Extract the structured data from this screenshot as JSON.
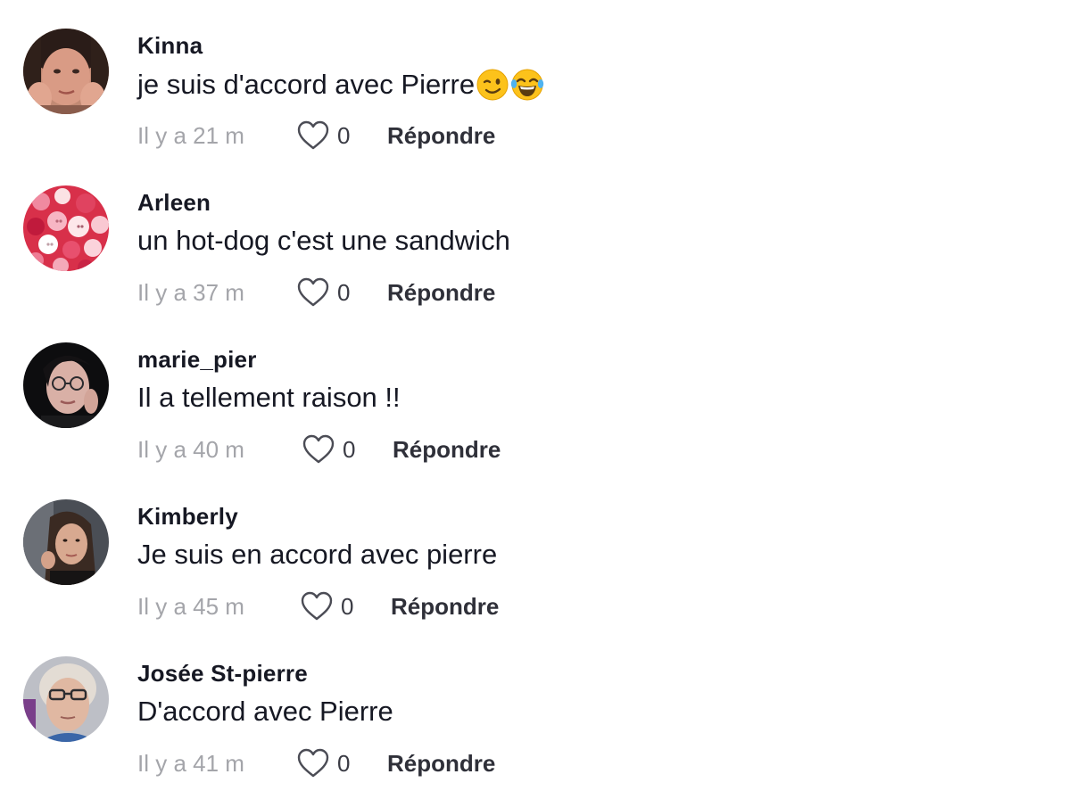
{
  "comments": [
    {
      "username": "Kinna",
      "text": "je suis d'accord avec Pierre",
      "emojis": [
        "winking-face",
        "face-with-tears-of-joy"
      ],
      "time": "Il y a 21 m",
      "likes": "0",
      "reply_label": "Répondre"
    },
    {
      "username": "Arleen",
      "text": "un hot-dog c'est une sandwich",
      "time": "Il y a 37 m",
      "likes": "0",
      "reply_label": "Répondre"
    },
    {
      "username": "marie_pier",
      "text": "Il a tellement raison !!",
      "time": "Il y a 40 m",
      "likes": "0",
      "reply_label": "Répondre"
    },
    {
      "username": "Kimberly",
      "text": "Je suis en accord avec pierre",
      "time": "Il y a 45 m",
      "likes": "0",
      "reply_label": "Répondre"
    },
    {
      "username": "Josée St-pierre",
      "text": "D'accord avec Pierre",
      "time": "Il y a 41 m",
      "likes": "0",
      "reply_label": "Répondre"
    }
  ],
  "icons": {
    "like": "heart-outline-icon"
  },
  "colors": {
    "text": "#161823",
    "muted": "#a4a5aa",
    "background": "#ffffff"
  }
}
